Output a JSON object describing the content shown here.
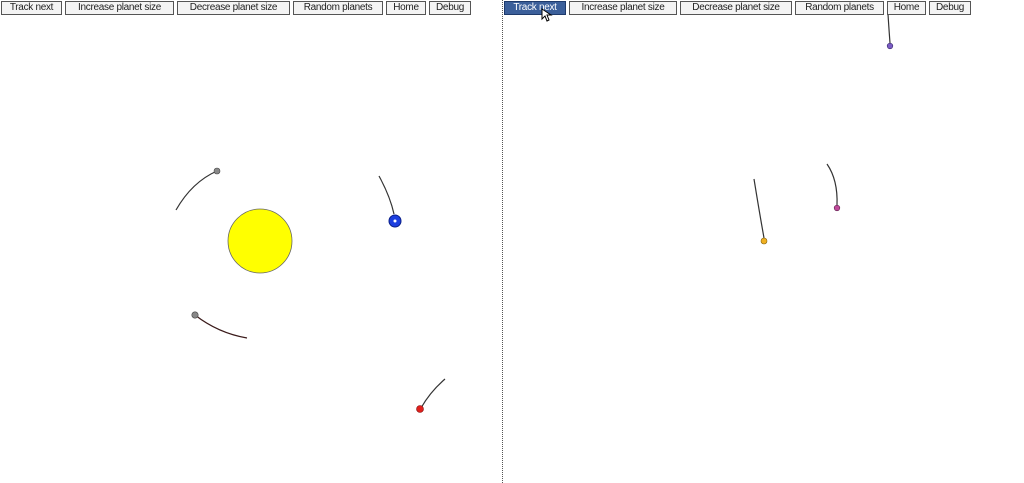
{
  "left_view": {
    "buttons": [
      {
        "id": "track-next",
        "label": "Track next"
      },
      {
        "id": "increase-planet-size",
        "label": "Increase planet size"
      },
      {
        "id": "decrease-planet-size",
        "label": "Decrease planet size"
      },
      {
        "id": "random-planets",
        "label": "Random planets"
      },
      {
        "id": "home",
        "label": "Home"
      },
      {
        "id": "debug",
        "label": "Debug"
      }
    ]
  },
  "right_view": {
    "buttons": [
      {
        "id": "track-next",
        "label": "Track next",
        "active": true
      },
      {
        "id": "increase-planet-size",
        "label": "Increase planet size"
      },
      {
        "id": "decrease-planet-size",
        "label": "Decrease planet size"
      },
      {
        "id": "random-planets",
        "label": "Random planets"
      },
      {
        "id": "home",
        "label": "Home"
      },
      {
        "id": "debug",
        "label": "Debug"
      }
    ]
  },
  "colors": {
    "sun": "#ffff00",
    "planet_blue": "#1c3fe0",
    "planet_red": "#e0201c",
    "planet_gray": "#888888",
    "planet_purple": "#7b5cc4",
    "planet_orange": "#f0b020",
    "planet_pink": "#c04a9a",
    "active_button": "#3b5f9a"
  }
}
